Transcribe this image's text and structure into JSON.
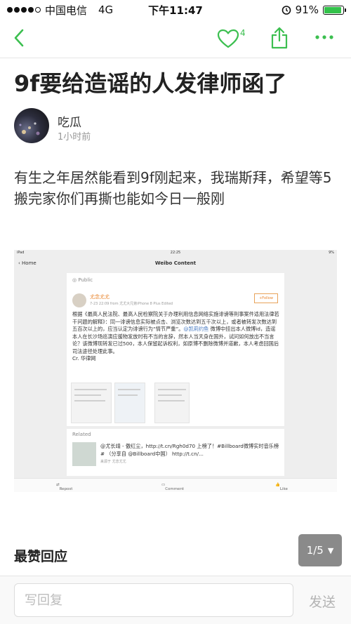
{
  "status_bar": {
    "carrier": "中国电信",
    "network": "4G",
    "time": "下午11:47",
    "battery_text": "91%",
    "battery_level": 0.91,
    "signal_bars": 4
  },
  "nav": {
    "like_count": "4",
    "accent_color": "#3cbf50"
  },
  "post": {
    "title": "9f要给造谣的人发律师函了",
    "author": "吃瓜",
    "time": "1小时前",
    "body": "有生之年居然能看到9f刚起来，我瑞斯拜，希望等5搬完家你们再撕也能如今日一般刚"
  },
  "embedded_screenshot": {
    "status_left": "iPad",
    "status_time": "22:25",
    "status_right": "9%",
    "back_label": "Home",
    "title": "Weibo Content",
    "public_label": "Public",
    "user_name": "尤念尤尤",
    "meta": "7-23 22:09  from 尤尤大兄弟iPhone 8 Plus  Edited",
    "follow_label": "+Follow",
    "text_before_mention": "根据《最高人民法院、最高人民检察院关于办理利用信息网络实施诽谤等刑事案件适用法律若干问题的解释》：同一诽谤信息实际被点击、浏览次数达到五千次以上，或者被转发次数达到五百次以上的，应当认定为诽谤行为“情节严重”。",
    "mention": "@凯莉约鱼",
    "text_after_mention": " 微博中挂出本人微博id，造谣本人在长沙场巡演应援物发放时有不当的言辞，然本人当天身在国外，试问如何放出不当言论？该微博现转发已过500，本人保留起诉权利，如原博不删除微博并道歉，本人考虑回国后司法途径处理此事。",
    "credit": "Cr. 华律网",
    "related_label": "Related",
    "related_text": "@尤长靖 - 傲红尘，http://t.cn/Rgh0d70 上榜了！#Billboard微博实时音乐榜# （分享自 @Billboard中国） http://t.cn/...",
    "related_source": "来源于 尤念尤尤",
    "footer": {
      "repost": "Repost",
      "comment": "Comment",
      "like": "Like"
    }
  },
  "comments_section": {
    "title": "最赞回应",
    "page_indicator": "1/5"
  },
  "reply_bar": {
    "placeholder": "写回复",
    "send_label": "发送"
  },
  "icons": [
    "back-icon",
    "heart-icon",
    "share-icon",
    "more-icon",
    "alarm-icon",
    "battery-icon",
    "caret-down-icon"
  ]
}
